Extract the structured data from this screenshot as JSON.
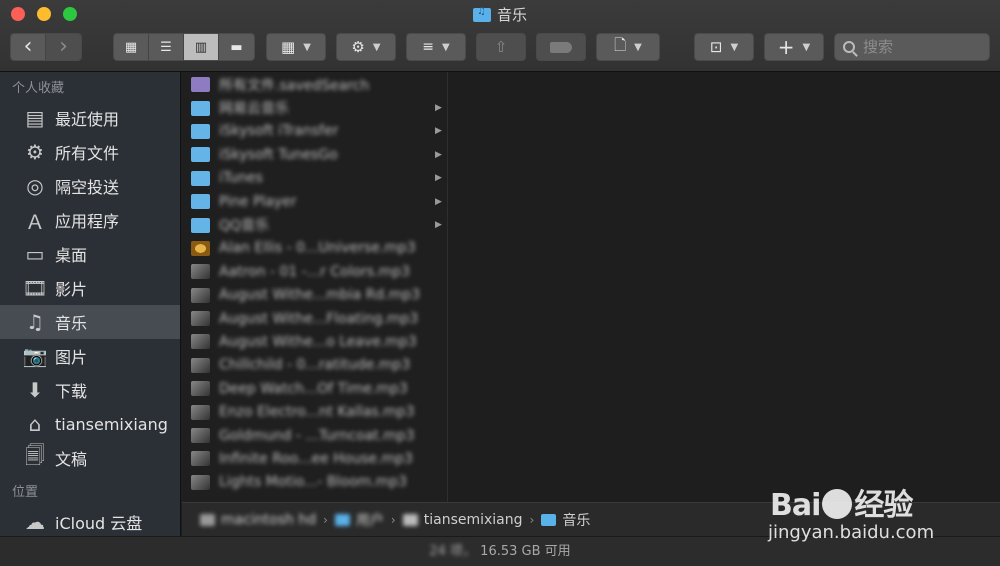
{
  "window": {
    "title": "音乐"
  },
  "toolbar": {
    "back": "‹",
    "forward": "›",
    "search_placeholder": "搜索"
  },
  "sidebar": {
    "favorites_heading": "个人收藏",
    "items": [
      {
        "label": "最近使用",
        "icon": "recents-icon"
      },
      {
        "label": "所有文件",
        "icon": "all-files-icon"
      },
      {
        "label": "隔空投送",
        "icon": "airdrop-icon"
      },
      {
        "label": "应用程序",
        "icon": "applications-icon"
      },
      {
        "label": "桌面",
        "icon": "desktop-icon"
      },
      {
        "label": "影片",
        "icon": "movies-icon"
      },
      {
        "label": "音乐",
        "icon": "music-icon",
        "selected": true
      },
      {
        "label": "图片",
        "icon": "pictures-icon"
      },
      {
        "label": "下载",
        "icon": "downloads-icon"
      },
      {
        "label": "tiansemixiang",
        "icon": "home-icon"
      },
      {
        "label": "文稿",
        "icon": "documents-icon"
      }
    ],
    "locations_heading": "位置",
    "locations": [
      {
        "label": "iCloud 云盘",
        "icon": "icloud-icon"
      }
    ]
  },
  "files": [
    {
      "name": "所有文件.savedSearch",
      "kind": "smart"
    },
    {
      "name": "网易云音乐",
      "kind": "folder"
    },
    {
      "name": "iSkysoft iTransfer",
      "kind": "folder"
    },
    {
      "name": "iSkysoft TunesGo",
      "kind": "folder"
    },
    {
      "name": "iTunes",
      "kind": "folder"
    },
    {
      "name": "Pine Player",
      "kind": "folder"
    },
    {
      "name": "QQ音乐",
      "kind": "folder"
    },
    {
      "name": "Alan Ellis - 0...Universe.mp3",
      "kind": "audio"
    },
    {
      "name": "Aatron - 01 -...r Colors.mp3",
      "kind": "audio"
    },
    {
      "name": "August Withe...mbia Rd.mp3",
      "kind": "audio"
    },
    {
      "name": "August Withe...Floating.mp3",
      "kind": "audio"
    },
    {
      "name": "August Withe...o Leave.mp3",
      "kind": "audio"
    },
    {
      "name": "Chillchild - 0...ratitude.mp3",
      "kind": "audio"
    },
    {
      "name": "Deep Watch...Of Time.mp3",
      "kind": "audio"
    },
    {
      "name": "Enzo Electro...nt Kallas.mp3",
      "kind": "audio"
    },
    {
      "name": "Goldmund - ...Turncoat.mp3",
      "kind": "audio"
    },
    {
      "name": "Infinite Roo...ee House.mp3",
      "kind": "audio"
    },
    {
      "name": "Lights Motio...- Bloom.mp3",
      "kind": "audio"
    }
  ],
  "pathbar": {
    "disk": "macintosh hd",
    "users": "用户",
    "home": "tiansemixiang",
    "current": "音乐"
  },
  "status": {
    "count": "24 项，",
    "free": "16.53 GB 可用"
  },
  "watermark": {
    "logo_left": "Bai",
    "logo_right": "经验",
    "url": "jingyan.baidu.com"
  },
  "colors": {
    "sidebar_bg": "#2b2f36",
    "folder": "#64b4e8",
    "selection": "#474b52"
  }
}
